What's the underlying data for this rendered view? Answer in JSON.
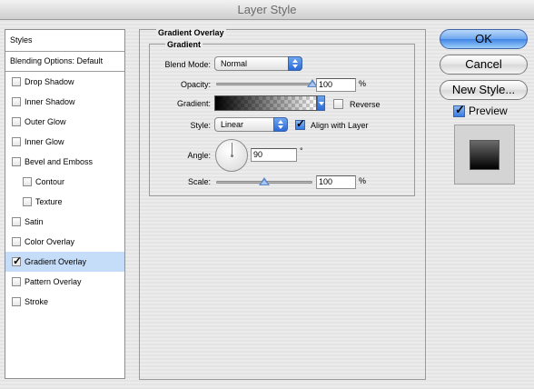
{
  "window": {
    "title": "Layer Style"
  },
  "sidebar": {
    "header": "Styles",
    "blending": "Blending Options: Default",
    "items": [
      {
        "label": "Drop Shadow",
        "checked": false,
        "indent": false
      },
      {
        "label": "Inner Shadow",
        "checked": false,
        "indent": false
      },
      {
        "label": "Outer Glow",
        "checked": false,
        "indent": false
      },
      {
        "label": "Inner Glow",
        "checked": false,
        "indent": false
      },
      {
        "label": "Bevel and Emboss",
        "checked": false,
        "indent": false
      },
      {
        "label": "Contour",
        "checked": false,
        "indent": true
      },
      {
        "label": "Texture",
        "checked": false,
        "indent": true
      },
      {
        "label": "Satin",
        "checked": false,
        "indent": false
      },
      {
        "label": "Color Overlay",
        "checked": false,
        "indent": false
      },
      {
        "label": "Gradient Overlay",
        "checked": true,
        "indent": false,
        "selected": true
      },
      {
        "label": "Pattern Overlay",
        "checked": false,
        "indent": false
      },
      {
        "label": "Stroke",
        "checked": false,
        "indent": false
      }
    ]
  },
  "panel": {
    "title": "Gradient Overlay",
    "group": "Gradient",
    "blend_mode": {
      "label": "Blend Mode:",
      "value": "Normal"
    },
    "opacity": {
      "label": "Opacity:",
      "value": "100",
      "unit": "%",
      "level": 1.0
    },
    "gradient": {
      "label": "Gradient:",
      "reverse_label": "Reverse",
      "reverse_checked": false
    },
    "style": {
      "label": "Style:",
      "value": "Linear",
      "align_label": "Align with Layer",
      "align_checked": true
    },
    "angle": {
      "label": "Angle:",
      "value": "90",
      "unit": "°"
    },
    "scale": {
      "label": "Scale:",
      "value": "100",
      "unit": "%",
      "level": 0.5
    }
  },
  "buttons": {
    "ok": "OK",
    "cancel": "Cancel",
    "new_style": "New Style..."
  },
  "preview": {
    "label": "Preview",
    "checked": true
  }
}
